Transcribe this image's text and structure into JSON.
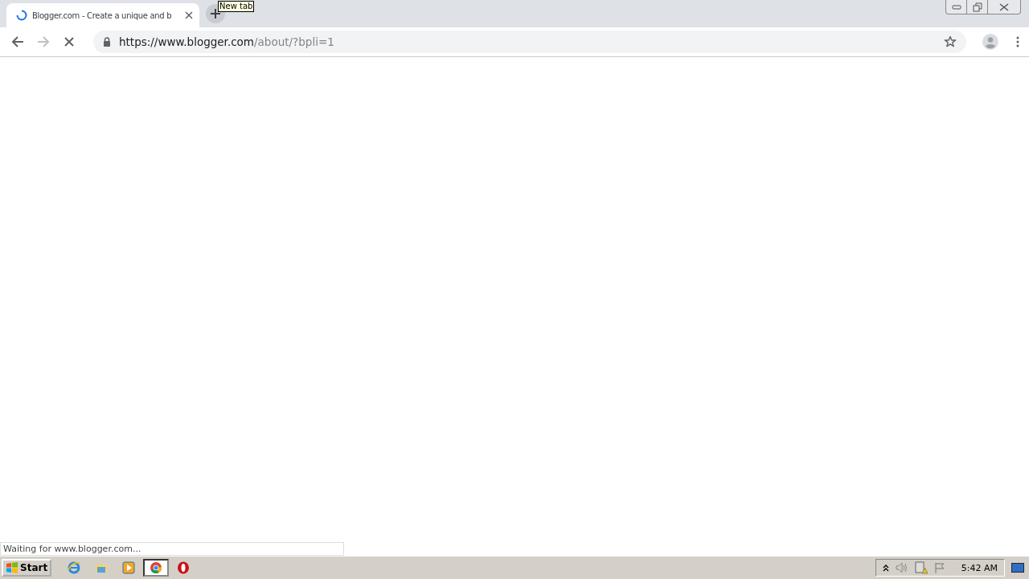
{
  "tabs": [
    {
      "title": "Blogger.com - Create a unique and b",
      "selected": true,
      "loading": true
    }
  ],
  "new_tab_tooltip": "New tab",
  "toolbar": {
    "forward_disabled": true,
    "loading": true,
    "url": {
      "host": "https://www.blogger.com",
      "path": "/about/?bpli=1"
    },
    "bookmarked": false
  },
  "status_bubble": "Waiting for www.blogger.com...",
  "taskbar": {
    "start": "Start",
    "apps": [
      {
        "kind": "ie",
        "selected": false
      },
      {
        "kind": "explorer",
        "selected": false
      },
      {
        "kind": "media",
        "selected": false
      },
      {
        "kind": "chrome",
        "selected": true
      },
      {
        "kind": "opera",
        "selected": false
      }
    ],
    "clock": "5:42 AM"
  }
}
